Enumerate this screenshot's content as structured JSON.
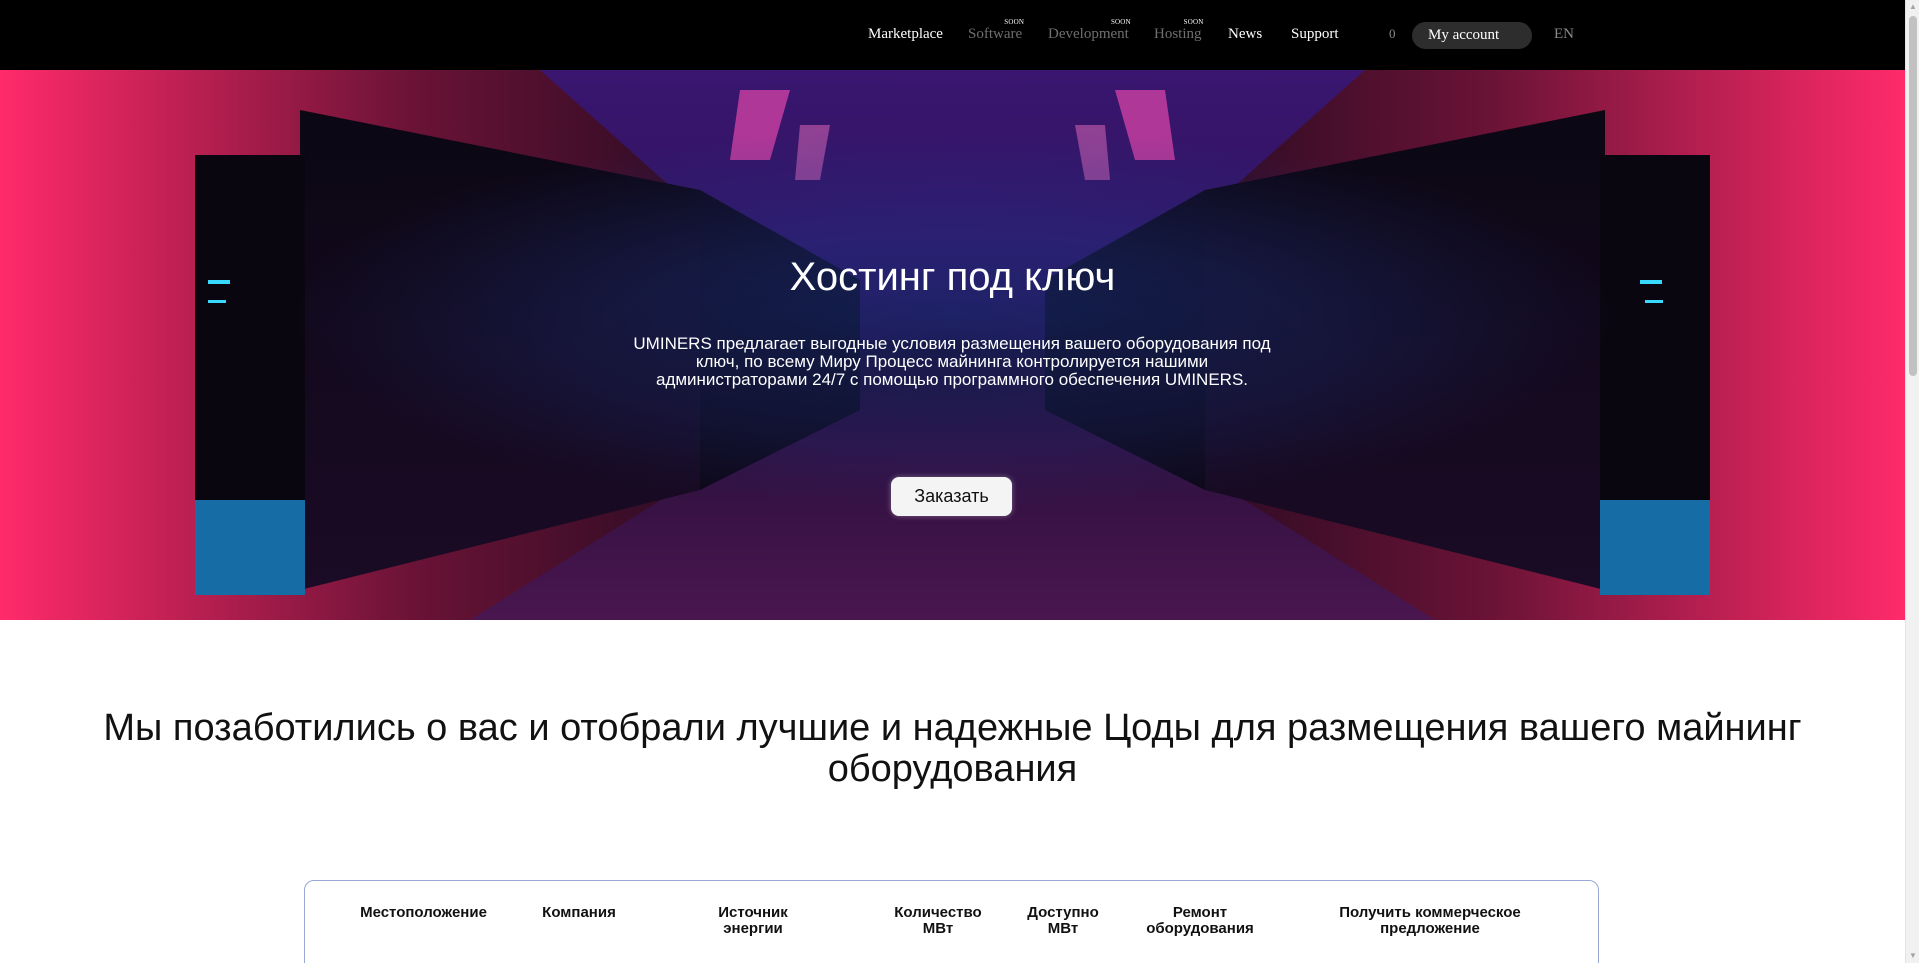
{
  "nav": {
    "items": [
      {
        "label": "Marketplace"
      },
      {
        "label": "Software",
        "badge": "SOON"
      },
      {
        "label": "Development",
        "badge": "SOON"
      },
      {
        "label": "Hosting",
        "badge": "SOON"
      },
      {
        "label": "News"
      },
      {
        "label": "Support"
      }
    ],
    "cart_count": "0",
    "account_label": "My account",
    "language": "EN"
  },
  "hero": {
    "title": "Хостинг под ключ",
    "description": "UMINERS предлагает выгодные условия размещения вашего оборудования под ключ, по всему Миру Процесс майнинга контролируется нашими администраторами 24/7 с помощью программного обеспечения UMINERS.",
    "button_label": "Заказать",
    "background": "dark server corridor with pink and blue lighting"
  },
  "section": {
    "title": "Мы позаботились о вас и отобрали лучшие и надежные Цоды для размещения вашего майнинг оборудования"
  },
  "table": {
    "columns": [
      "Местоположение",
      "Компания",
      "Источник энергии",
      "Количество МВт",
      "Доступно МВт",
      "Ремонт оборудования",
      "Получить коммерческое предложение"
    ]
  },
  "colors": {
    "topbar": "#000000",
    "accent_pink": "#ff1e6e",
    "accent_purple": "#6a1b9a",
    "accent_cyan": "#29c8ff",
    "table_border": "#9aa6d6"
  }
}
